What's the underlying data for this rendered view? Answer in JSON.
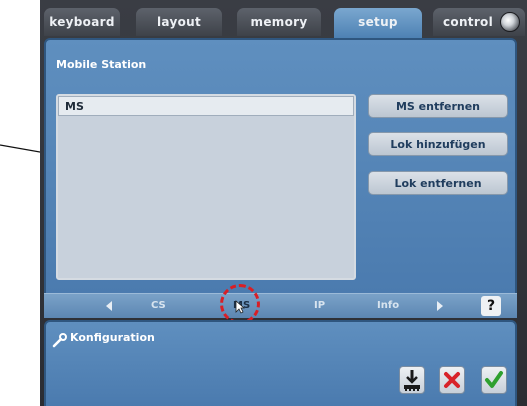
{
  "tabs": [
    {
      "label": "keyboard",
      "active": false
    },
    {
      "label": "layout",
      "active": false
    },
    {
      "label": "memory",
      "active": false
    },
    {
      "label": "setup",
      "active": true
    },
    {
      "label": "control",
      "active": false
    }
  ],
  "panel": {
    "title": "Mobile Station",
    "list_items": [
      "MS"
    ],
    "buttons": {
      "remove_ms": "MS entfernen",
      "add_loco": "Lok hinzufügen",
      "remove_loco": "Lok entfernen"
    }
  },
  "subtabs": {
    "items": [
      "CS",
      "MS",
      "IP",
      "Info"
    ],
    "selected": "MS",
    "help": "?"
  },
  "config": {
    "title": "Konfiguration"
  },
  "icons": {
    "control": "gear-icon",
    "config": "wrench-icon",
    "import": "import-icon",
    "cancel": "close-icon",
    "ok": "check-icon"
  },
  "colors": {
    "accent_active_tab": "#5d92c4",
    "panel": "#5282b5",
    "highlight": "#d81f26",
    "cancel": "#d8232a",
    "ok": "#2ea02f"
  }
}
